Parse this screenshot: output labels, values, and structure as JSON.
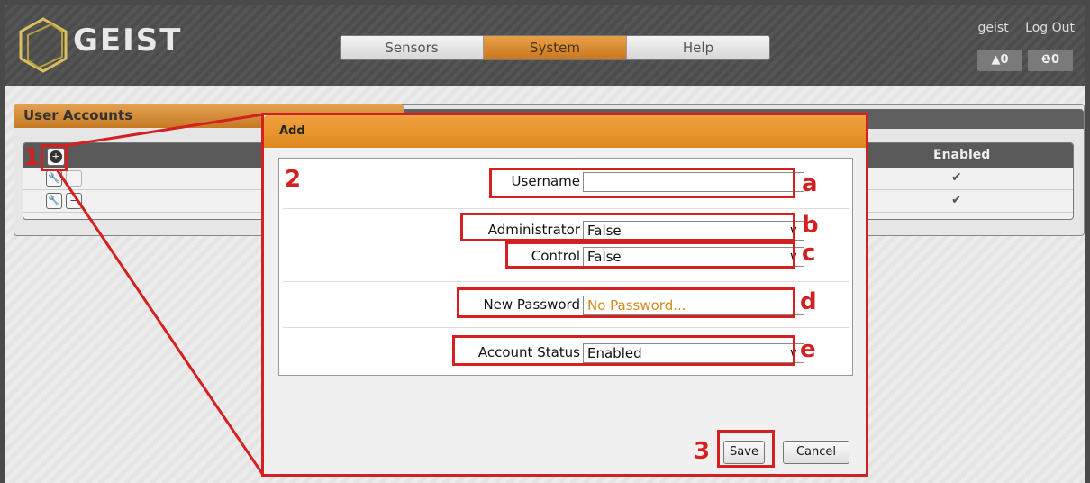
{
  "header": {
    "logo_text": "GEIST",
    "nav_tabs": [
      {
        "label": "Sensors",
        "active": false
      },
      {
        "label": "System",
        "active": true
      },
      {
        "label": "Help",
        "active": false
      }
    ],
    "username": "geist",
    "logout_label": "Log Out",
    "alarm_warning": "▲0",
    "alarm_error": "❶0"
  },
  "user_accounts": {
    "title": "User Accounts",
    "column_enabled": "Enabled",
    "rows": [
      {
        "enabled": "✔"
      },
      {
        "enabled": "✔"
      }
    ]
  },
  "modal": {
    "title": "Add",
    "username_label": "Username",
    "username_value": "",
    "administrator_label": "Administrator",
    "administrator_value": "False",
    "control_label": "Control",
    "control_value": "False",
    "password_label": "New Password",
    "password_placeholder": "No Password...",
    "account_status_label": "Account Status",
    "account_status_value": "Enabled",
    "save_label": "Save",
    "cancel_label": "Cancel"
  },
  "annotations": {
    "n1": "1",
    "n2": "2",
    "n3": "3",
    "a": "a",
    "b": "b",
    "c": "c",
    "d": "d",
    "e": "e"
  },
  "colors": {
    "accent_orange": "#df8a20",
    "annotation_red": "#d42020"
  }
}
